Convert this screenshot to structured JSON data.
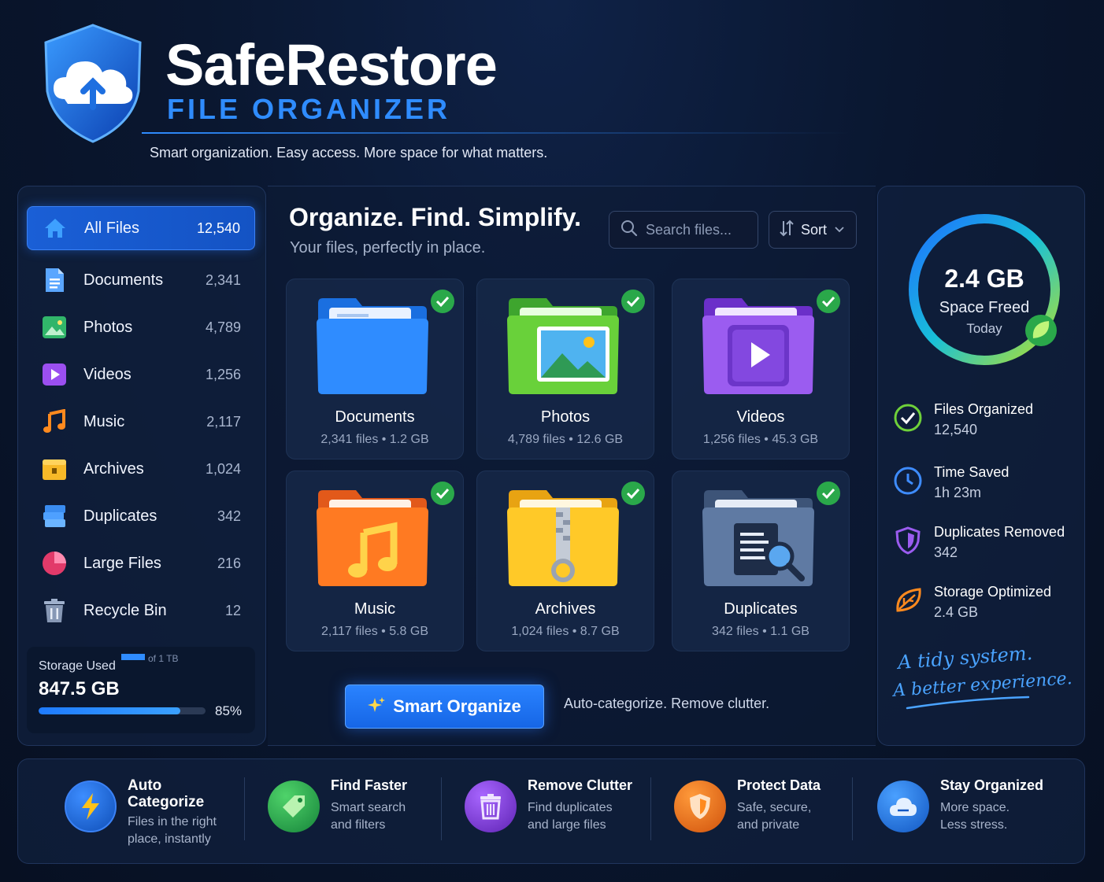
{
  "brand": {
    "title": "SafeRestore",
    "subtitle": "FILE ORGANIZER",
    "tagline": "Smart organization. Easy access. More space for what matters."
  },
  "sidebar": {
    "items": [
      {
        "label": "All Files",
        "count": "12,540",
        "icon": "home-icon"
      },
      {
        "label": "Documents",
        "count": "2,341",
        "icon": "document-icon"
      },
      {
        "label": "Photos",
        "count": "4,789",
        "icon": "photo-icon"
      },
      {
        "label": "Videos",
        "count": "1,256",
        "icon": "video-icon"
      },
      {
        "label": "Music",
        "count": "2,117",
        "icon": "music-icon"
      },
      {
        "label": "Archives",
        "count": "1,024",
        "icon": "archive-icon"
      },
      {
        "label": "Duplicates",
        "count": "342",
        "icon": "duplicates-icon"
      },
      {
        "label": "Large Files",
        "count": "216",
        "icon": "pie-chart-icon"
      },
      {
        "label": "Recycle Bin",
        "count": "12",
        "icon": "trash-icon"
      }
    ],
    "storage": {
      "label": "Storage Used",
      "of_label": "of 1 TB",
      "value": "847.5 GB",
      "percent_label": "85%",
      "percent": 85
    }
  },
  "main": {
    "title": "Organize. Find. Simplify.",
    "subtitle": "Your files, perfectly in place.",
    "search": {
      "placeholder": "Search files..."
    },
    "sort_label": "Sort",
    "cards": [
      {
        "name": "Documents",
        "meta": "2,341 files • 1.2 GB",
        "icon": "blue-folder-icon"
      },
      {
        "name": "Photos",
        "meta": "4,789 files • 12.6 GB",
        "icon": "photo-folder-icon"
      },
      {
        "name": "Videos",
        "meta": "1,256 files • 45.3 GB",
        "icon": "video-folder-icon"
      },
      {
        "name": "Music",
        "meta": "2,117 files • 5.8 GB",
        "icon": "music-folder-icon"
      },
      {
        "name": "Archives",
        "meta": "1,024 files • 8.7 GB",
        "icon": "zip-folder-icon"
      },
      {
        "name": "Duplicates",
        "meta": "342 files • 1.1 GB",
        "icon": "search-folder-icon"
      }
    ],
    "smart_button": "Smart Organize",
    "smart_desc": "Auto-categorize. Remove clutter."
  },
  "summary": {
    "ring_value": "2.4 GB",
    "ring_label": "Space Freed",
    "ring_sub": "Today",
    "stats": [
      {
        "label": "Files Organized",
        "value": "12,540",
        "icon": "check-circle-icon"
      },
      {
        "label": "Time Saved",
        "value": "1h 23m",
        "icon": "clock-icon"
      },
      {
        "label": "Duplicates Removed",
        "value": "342",
        "icon": "shield-icon"
      },
      {
        "label": "Storage Optimized",
        "value": "2.4 GB",
        "icon": "leaf-icon"
      }
    ],
    "handwriting_line1": "A tidy system.",
    "handwriting_line2": "A better experience."
  },
  "features": [
    {
      "title": "Auto\nCategorize",
      "desc": "Files in the right\nplace, instantly",
      "icon": "lightning-icon",
      "color": "#1d6fe0"
    },
    {
      "title": "Find Faster",
      "desc": "Smart search\nand filters",
      "icon": "tag-icon",
      "color": "#22a04a"
    },
    {
      "title": "Remove Clutter",
      "desc": "Find duplicates\nand large files",
      "icon": "trash-icon",
      "color": "#8a3fd6"
    },
    {
      "title": "Protect Data",
      "desc": "Safe, secure,\nand private",
      "icon": "shield-icon",
      "color": "#f07a1a"
    },
    {
      "title": "Stay Organized",
      "desc": "More space.\nLess stress.",
      "icon": "cloud-icon",
      "color": "#1f78e6"
    }
  ],
  "colors": {
    "accent": "#2f8cff",
    "success": "#2aa84a"
  }
}
